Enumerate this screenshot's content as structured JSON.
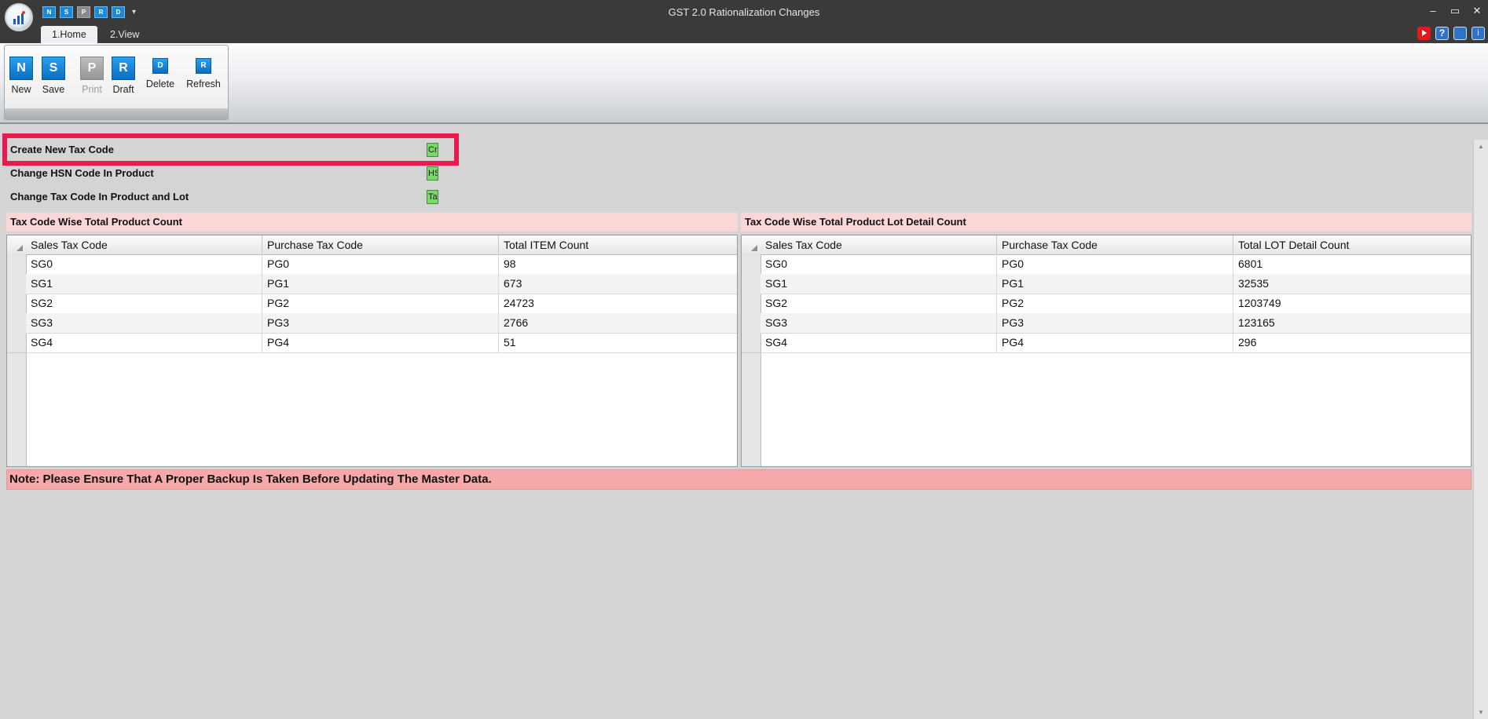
{
  "window": {
    "title": "GST 2.0 Rationalization Changes",
    "controls": [
      "–",
      "▭",
      "✕"
    ]
  },
  "quick_access": [
    {
      "label": "N",
      "icon": "new-icon",
      "enabled": true
    },
    {
      "label": "S",
      "icon": "save-icon",
      "enabled": true
    },
    {
      "label": "P",
      "icon": "print-icon",
      "enabled": false
    },
    {
      "label": "R",
      "icon": "draft-icon",
      "enabled": true
    },
    {
      "label": "D",
      "icon": "delete-icon",
      "enabled": true
    }
  ],
  "tabs": [
    {
      "label": "1.Home",
      "active": true
    },
    {
      "label": "2.View",
      "active": false
    }
  ],
  "help_icons": [
    "youtube-icon",
    "help-icon",
    "notes-icon",
    "info-icon"
  ],
  "ribbon": {
    "buttons": [
      {
        "label": "New",
        "glyph": "N",
        "enabled": true
      },
      {
        "label": "Save",
        "glyph": "S",
        "enabled": true
      },
      {
        "label": "Print",
        "glyph": "P",
        "enabled": false
      },
      {
        "label": "Draft",
        "glyph": "R",
        "enabled": true
      },
      {
        "label": "Delete",
        "glyph": "D",
        "enabled": true
      },
      {
        "label": "Refresh",
        "glyph": "R",
        "enabled": true
      }
    ]
  },
  "actions": [
    {
      "label": "Create New Tax Code",
      "button_text": "Cr"
    },
    {
      "label": "Change HSN Code In Product",
      "button_text": "HS"
    },
    {
      "label": "Change Tax Code In Product and Lot",
      "button_text": "Ta"
    }
  ],
  "left_panel": {
    "title": "Tax Code Wise Total Product Count",
    "columns": [
      "Sales Tax Code",
      "Purchase Tax Code",
      "Total ITEM Count"
    ],
    "rows": [
      [
        "SG0",
        "PG0",
        "98"
      ],
      [
        "SG1",
        "PG1",
        "673"
      ],
      [
        "SG2",
        "PG2",
        "24723"
      ],
      [
        "SG3",
        "PG3",
        "2766"
      ],
      [
        "SG4",
        "PG4",
        "51"
      ]
    ]
  },
  "right_panel": {
    "title": "Tax Code Wise Total Product Lot Detail Count",
    "columns": [
      "Sales Tax Code",
      "Purchase Tax Code",
      "Total LOT Detail Count"
    ],
    "rows": [
      [
        "SG0",
        "PG0",
        "6801"
      ],
      [
        "SG1",
        "PG1",
        "32535"
      ],
      [
        "SG2",
        "PG2",
        "1203749"
      ],
      [
        "SG3",
        "PG3",
        "123165"
      ],
      [
        "SG4",
        "PG4",
        "296"
      ]
    ]
  },
  "note": "Note: Please Ensure That A Proper Backup Is Taken Before Updating The Master Data.",
  "colors": {
    "highlight": "#ea1a4e",
    "action_button": "#7bd86b",
    "panel_header": "#fbd6d6",
    "note_bg": "#f7a8a8"
  }
}
